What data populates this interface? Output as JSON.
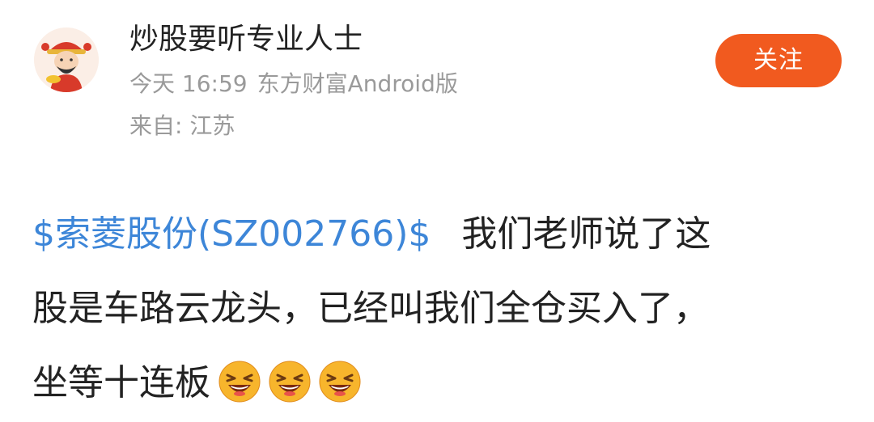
{
  "header": {
    "username": "炒股要听专业人士",
    "time": "今天 16:59",
    "client": "东方财富Android版",
    "location": "来自: 江苏",
    "follow_label": "关注"
  },
  "post": {
    "stock_link": "$索菱股份(SZ002766)$",
    "line1_text": "我们老师说了这",
    "line2_text": "股是车路云龙头，已经叫我们全仓买入了，",
    "line3_text": "坐等十连板",
    "emojis": [
      "laughing-emoji",
      "laughing-emoji",
      "laughing-emoji"
    ]
  },
  "colors": {
    "link": "#3d86d8",
    "follow_button": "#f15a1f",
    "secondary_text": "#9a9a9a"
  }
}
